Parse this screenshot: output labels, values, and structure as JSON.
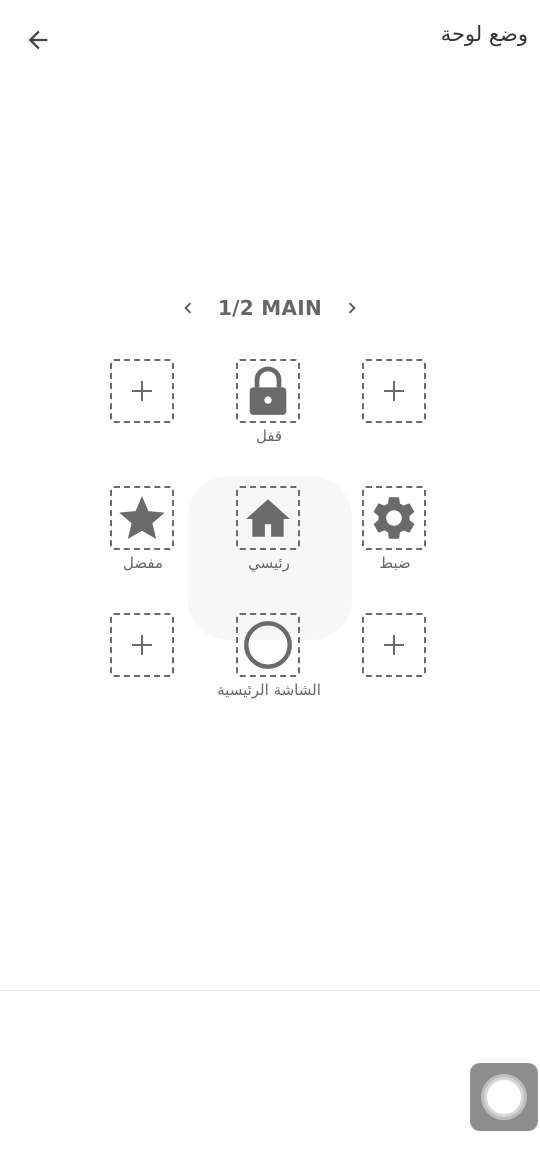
{
  "header": {
    "title": "وضع لوحة",
    "back_icon": "arrow-left-icon"
  },
  "pager": {
    "label": "1/2 MAIN",
    "prev_icon": "chevron-left-icon",
    "next_icon": "chevron-right-icon"
  },
  "grid": [
    {
      "icon": "plus-icon",
      "label": ""
    },
    {
      "icon": "lock-icon",
      "label": "قفل"
    },
    {
      "icon": "plus-icon",
      "label": ""
    },
    {
      "icon": "star-icon",
      "label": "مفضل"
    },
    {
      "icon": "home-icon",
      "label": "رئيسي"
    },
    {
      "icon": "gear-icon",
      "label": "ضبط"
    },
    {
      "icon": "plus-icon",
      "label": ""
    },
    {
      "icon": "circle-icon",
      "label": "الشاشة الرئيسية"
    },
    {
      "icon": "plus-icon",
      "label": ""
    }
  ],
  "floating_button": {
    "icon": "assistive-touch-icon"
  },
  "colors": {
    "icon_gray": "#6a6a6a",
    "text_dark": "#333333",
    "float_bg": "#8e8e8e"
  }
}
